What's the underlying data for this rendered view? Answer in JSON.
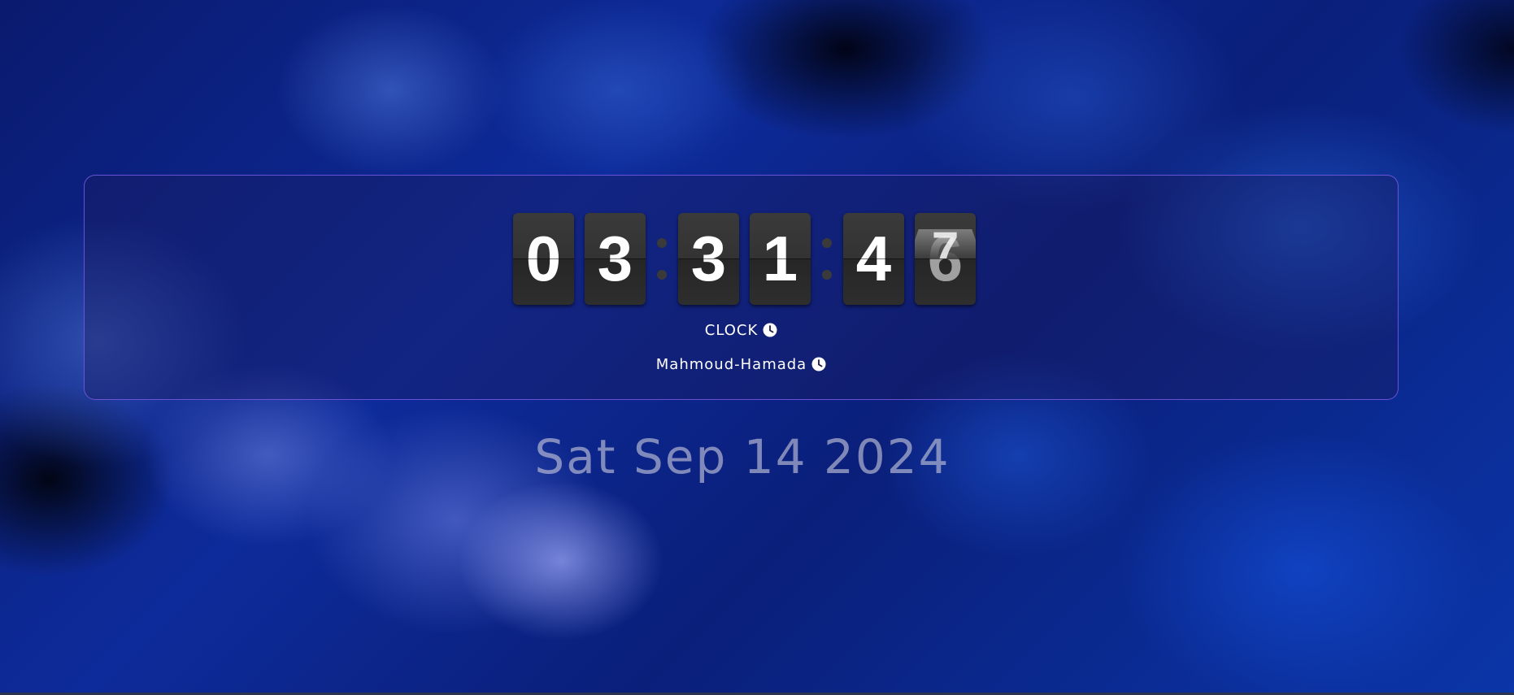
{
  "clock": {
    "hours": [
      "0",
      "3"
    ],
    "minutes": [
      "3",
      "1"
    ],
    "seconds": [
      "4",
      "7"
    ],
    "seconds_flip_under": "6",
    "title_label": "CLOCK",
    "author_label": "Mahmoud-Hamada"
  },
  "date": {
    "text": "Sat Sep 14 2024"
  },
  "icons": {
    "title_icon": "clock-icon",
    "author_icon": "clock-icon"
  },
  "colors": {
    "panel_border": "#7a5ae6",
    "digit_bg": "#333333",
    "digit_text": "#ffffff"
  }
}
